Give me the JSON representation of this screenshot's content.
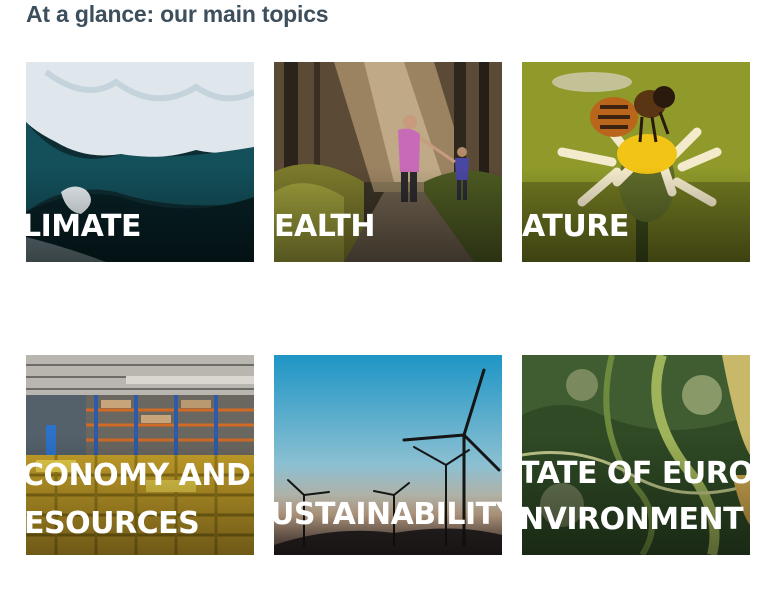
{
  "section": {
    "title": "At a glance: our main topics"
  },
  "topics": [
    {
      "label": "LIMATE"
    },
    {
      "label": "EALTH"
    },
    {
      "label": "ATURE"
    },
    {
      "label_line1": "CONOMY AND",
      "label_line2": "ESOURCES"
    },
    {
      "label": "USTAINABILITY"
    },
    {
      "label_line1": "TATE OF EUROP",
      "label_line2": "NVIRONMENT"
    }
  ]
}
